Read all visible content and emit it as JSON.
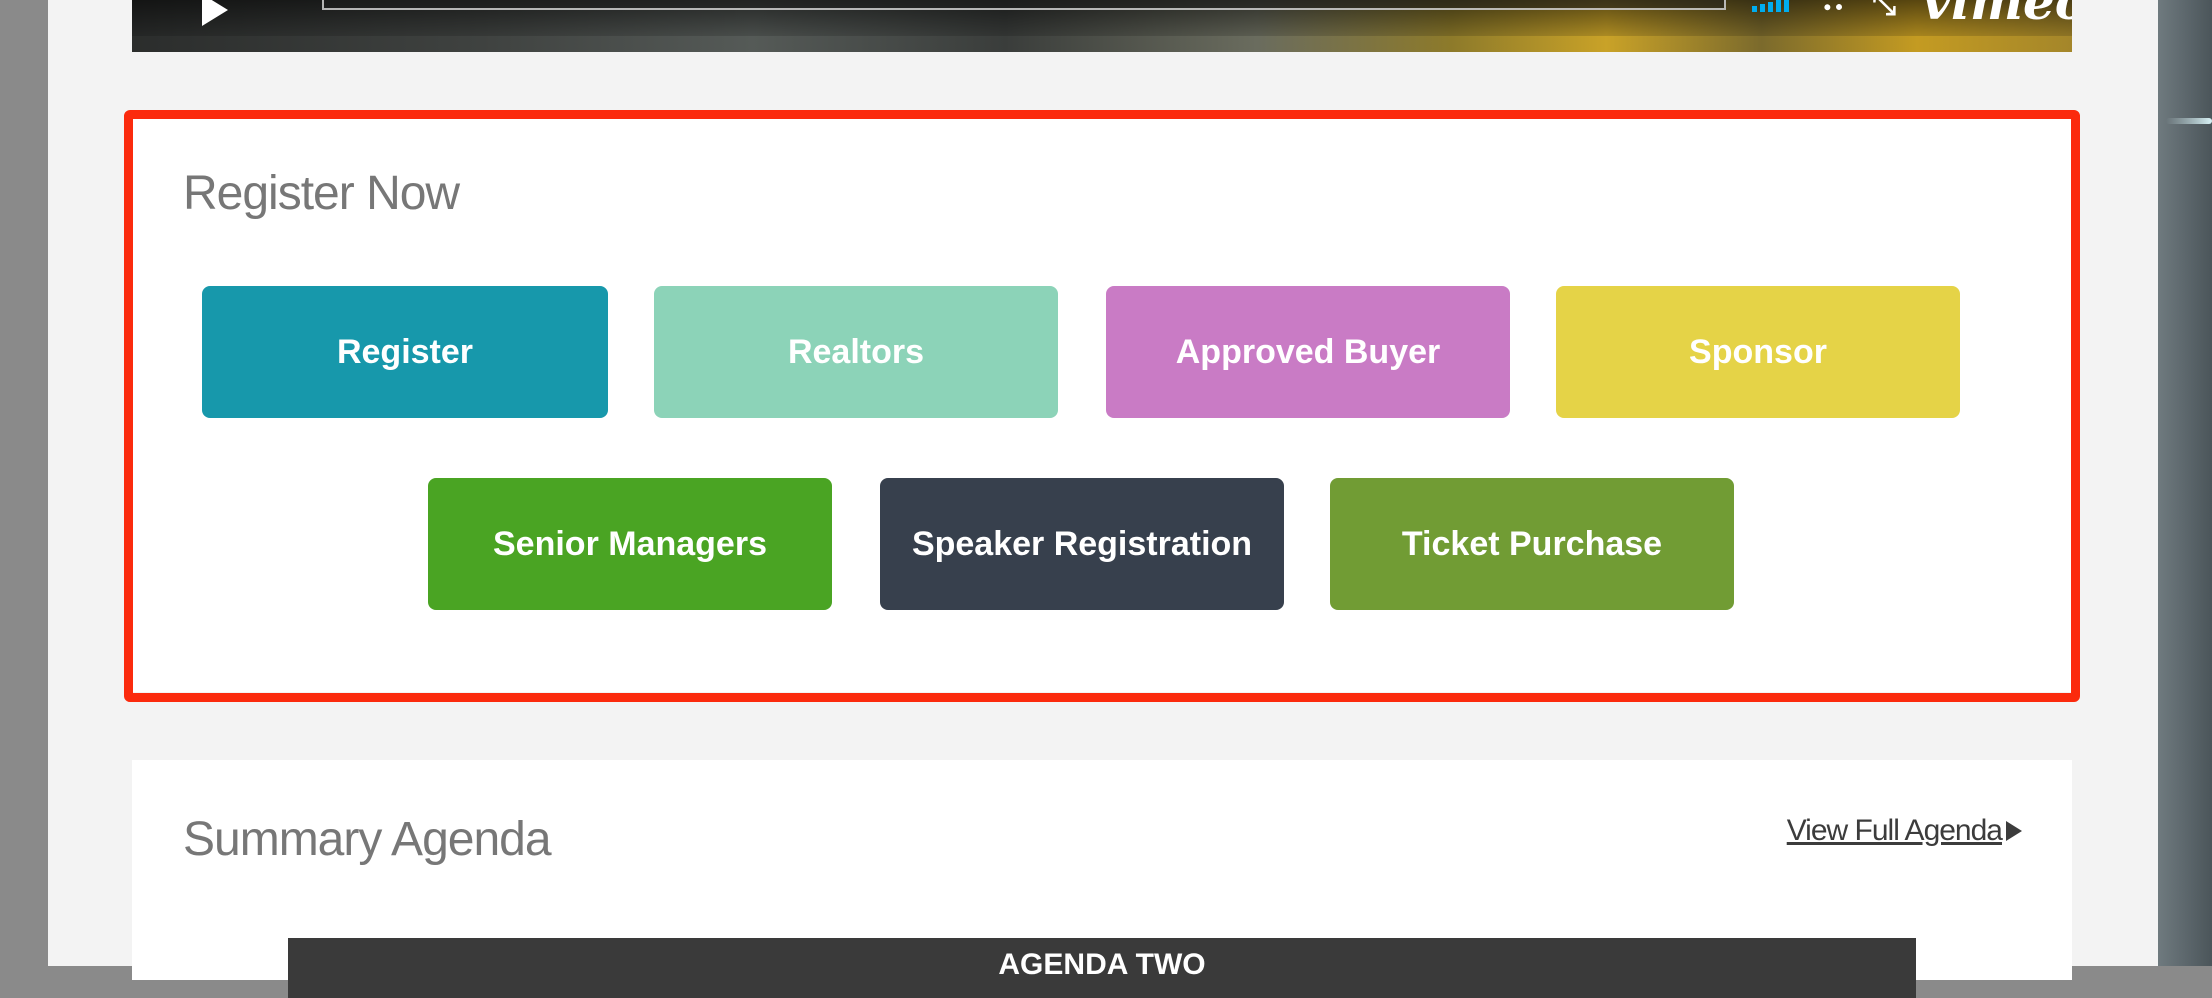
{
  "register_section": {
    "title": "Register Now",
    "buttons": [
      {
        "label": "Register",
        "color": "#1798ab"
      },
      {
        "label": "Realtors",
        "color": "#8cd3b8"
      },
      {
        "label": "Approved Buyer",
        "color": "#c97bc5"
      },
      {
        "label": "Sponsor",
        "color": "#e5d347"
      },
      {
        "label": "Senior Managers",
        "color": "#4aa423"
      },
      {
        "label": "Speaker Registration",
        "color": "#37404d"
      },
      {
        "label": "Ticket Purchase",
        "color": "#719c34"
      }
    ]
  },
  "agenda_section": {
    "title": "Summary Agenda",
    "view_full_link": "View Full Agenda",
    "table_header": "AGENDA TWO"
  },
  "video_player": {
    "logo": "vimeo",
    "accent_color": "#00adef"
  },
  "highlight_color": "#fb2a0d"
}
